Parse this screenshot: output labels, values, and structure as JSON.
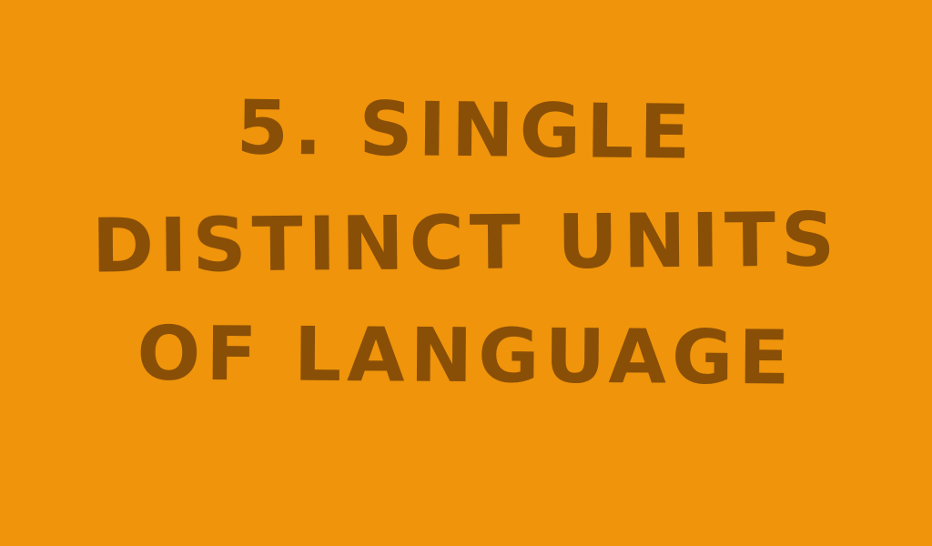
{
  "slide": {
    "title_lines": [
      "5. SiNGLE",
      "DiSTiNCT UNiTS",
      "OF LANGUAGE"
    ]
  },
  "colors": {
    "background": "#EF940B",
    "text": "#8A4F06"
  }
}
